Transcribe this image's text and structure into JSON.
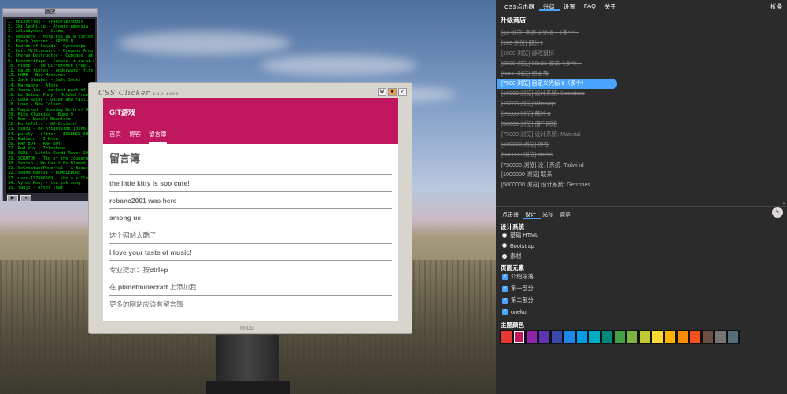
{
  "winamp": {
    "title": "播放",
    "tracks": [
      "1. 0d13strikk - 7r4h5r18750pu5",
      "2. 3killaphilip - Atomic Amnesia",
      "3. acloudyskye - Climb",
      "4. aekasora - helpless as a kitten",
      "5. Black Dresses - CREEP U",
      "6. Boards of Canada - Gyroscope",
      "7. Cats Millionaire - Dragons Aren't Suppo...",
      "8. Cherax Destructor - Cupcake (aterms)",
      "9. Eccentrifuge - Canvas (i aurai mes cout...",
      "10. Flume - The Difference (Feat. Toro y ...",
      "11. galen tipton - underwater fireflies",
      "12. HOME - New Machines",
      "13. Jack Stauber - Safe Socks",
      "14. Karnaboy - Alone",
      "15. laura les - darkest part of day",
      "16. Le Soldat Pony - Molded From Clay",
      "17. Lena Raine - Quiet and Falling",
      "18. Lone - New Colour",
      "19. Magicked - Someday Both of Us'll Meet",
      "20. Mike Klubnika - Bump 9",
      "21. Mom - Needle Mountain",
      "22. Northfalls - KK Cruisin'",
      "23. osno1 - mr brightside (osno1 remix)",
      "24. purity - r!tter - ESSENCE_SHIFT",
      "25. Radiarc - I Know",
      "26. RAP BOY - RAP BOY",
      "27. Red Vox - Telephone",
      "28. SSRL - Little Kandi Raver 2012",
      "29. SCRATON - Tip of the Iceberg",
      "30. Sevish - We Can't Be Blamed",
      "31. SoGreatandPowerful - A Beautiful Heart",
      "32. Sound Bandit - DUMBLEDORE",
      "33. user-177606669 - she a killer dat girl",
      "34. Vylet Pony - the yak song",
      "35. Yaeji - After That"
    ]
  },
  "monitor": {
    "title": "CSS Clicker",
    "title_small": "LAB 1000",
    "logo": "LG",
    "app_name": "GIT游戏",
    "tabs": [
      "首页",
      "博客",
      "留言簿"
    ],
    "page_title": "留言簿",
    "entries": [
      {
        "bold": "the little kitty is soo cute!",
        "pre": "",
        "post": ""
      },
      {
        "bold": "rebane2001 was here",
        "pre": "",
        "post": ""
      },
      {
        "bold": "among us",
        "pre": "",
        "post": ""
      },
      {
        "bold": "",
        "pre": "这个网站太酷了",
        "post": ""
      },
      {
        "bold": "i love your taste of music!",
        "pre": "",
        "post": ""
      },
      {
        "bold": "ctrl+p",
        "pre": "专业提示：按",
        "post": ""
      },
      {
        "bold": "planetminecraft",
        "pre": "在 ",
        "post": " 上添加我"
      },
      {
        "bold": "",
        "pre": "更多的网站应该有留言簿",
        "post": ""
      }
    ]
  },
  "panel": {
    "tabs": [
      "CSS点击器",
      "升级",
      "设置",
      "FAQ",
      "关于"
    ],
    "collapse": "折叠",
    "shop_title": "升级商店",
    "upgrades": [
      "[10 浏览] 自定义光标 I（多个）",
      "[100 浏览] 部分 I",
      "[1000 浏览] 游戏鼠标",
      "[2500 浏览] 88x31 徽章（多个）",
      "[5000 浏览] 留言簿",
      "[7500 浏览] 自定义光标 II（多个）",
      "[10000 浏览] 设计系统: Bootstrap",
      "[15000 浏览] Winamp",
      "[25000 浏览] 部分 II",
      "[50000 浏览] 僵尸网络",
      "[75000 浏览] 设计系统: Material",
      "[100000 浏览] 博客",
      "[500000 浏览] oneko",
      "[750000 浏览] 设计系统: Tailwind",
      "[1000000 浏览] 联系",
      "[5000000 浏览] 设计系统: Geocities"
    ],
    "sub_tabs": [
      "点击器",
      "设计",
      "光标",
      "徽章"
    ],
    "design_title": "设计系统",
    "design_options": [
      "基础 HTML",
      "Bootstrap",
      "素材"
    ],
    "elements_title": "页面元素",
    "elements": [
      "介绍段落",
      "第一部分",
      "第二部分",
      "oneko"
    ],
    "theme_title": "主题颜色",
    "colors": [
      "#e53935",
      "#c2185b",
      "#8e24aa",
      "#5e35b1",
      "#3949ab",
      "#1e88e5",
      "#039be5",
      "#00acc1",
      "#00897b",
      "#43a047",
      "#7cb342",
      "#c0ca33",
      "#fdd835",
      "#ffb300",
      "#fb8c00",
      "#f4511e",
      "#6d4c41",
      "#757575",
      "#546e7a"
    ]
  }
}
